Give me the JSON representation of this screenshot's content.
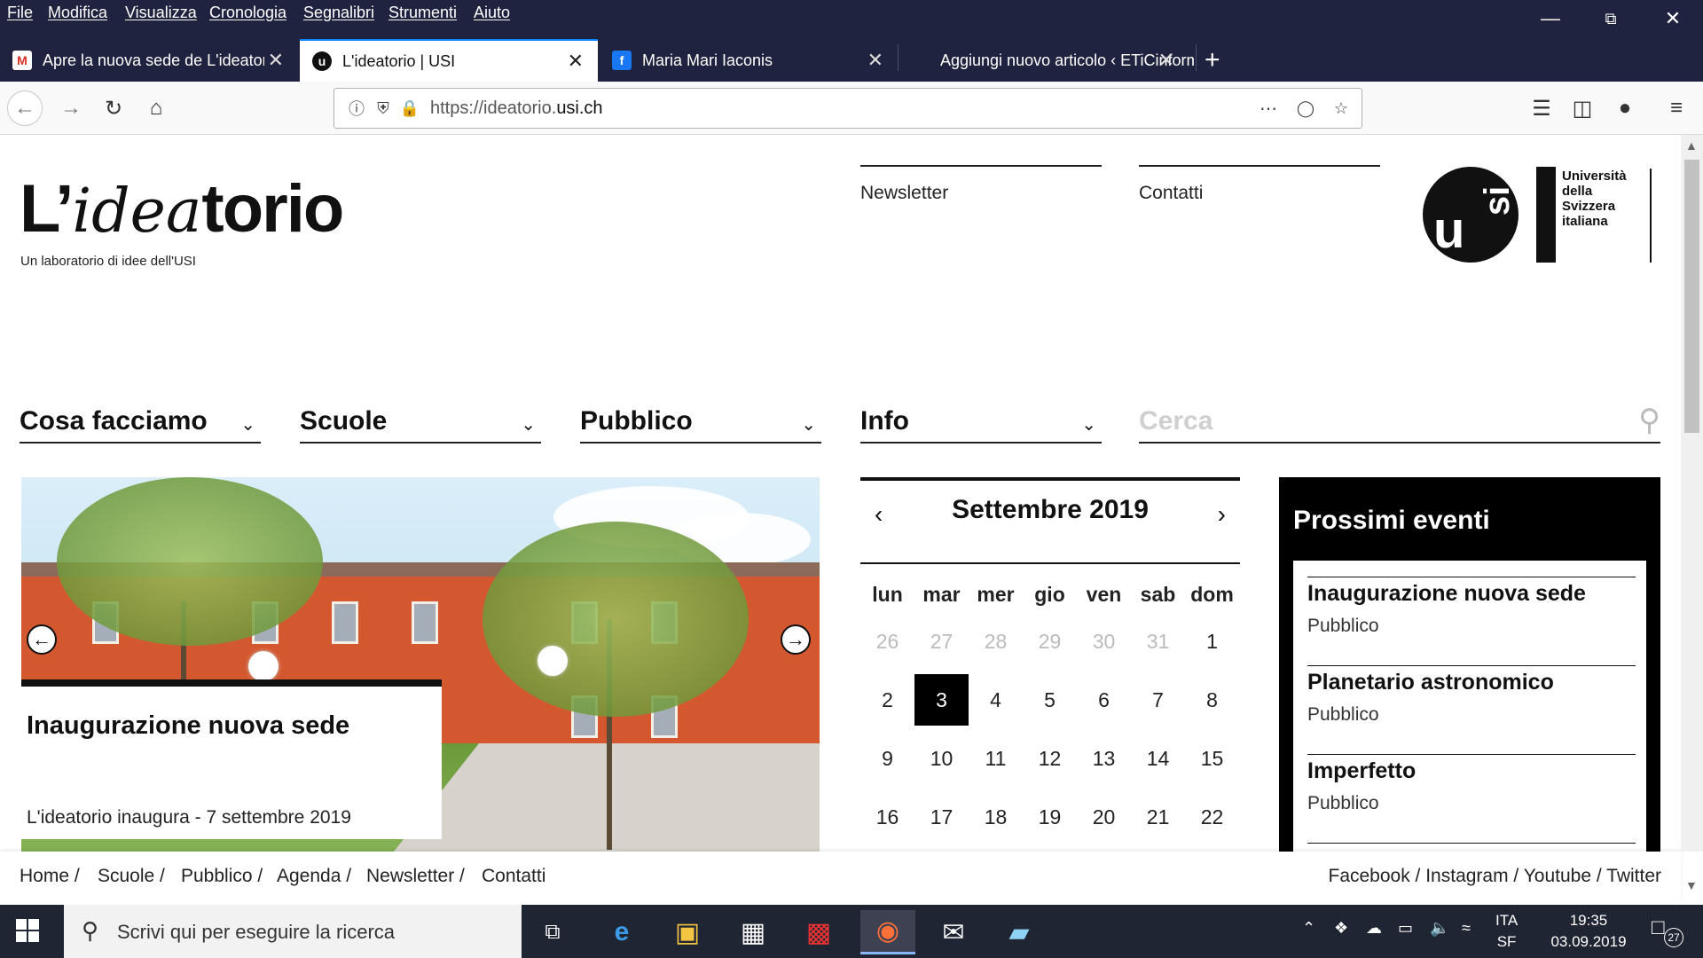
{
  "menubar": {
    "items": [
      "File",
      "Modifica",
      "Visualizza",
      "Cronologia",
      "Segnalibri",
      "Strumenti",
      "Aiuto"
    ]
  },
  "tabs": [
    {
      "title": "Apre la nuova sede de L'ideatorio",
      "favicon": "gmail-icon"
    },
    {
      "title": "L'ideatorio | USI",
      "favicon": "usi-icon",
      "active": true
    },
    {
      "title": "Maria Mari Iaconis",
      "favicon": "facebook-icon"
    },
    {
      "title": "Aggiungi nuovo articolo ‹ ETiCinforma",
      "favicon": "blank"
    }
  ],
  "urlbar": {
    "prefix": "https://ideatorio.",
    "domain": "usi.ch"
  },
  "site": {
    "logo_prefix": "L’",
    "logo_script": "idea",
    "logo_suffix": "torio",
    "tagline": "Un laboratorio di idee dell'USI",
    "top_links": [
      "Newsletter",
      "Contatti"
    ],
    "usi_lines": [
      "Università",
      "della",
      "Svizzera",
      "italiana"
    ],
    "usi_mark": {
      "u": "u",
      "si": "si"
    }
  },
  "mainnav": [
    "Cosa facciamo",
    "Scuole",
    "Pubblico",
    "Info"
  ],
  "search": {
    "placeholder": "Cerca"
  },
  "slider": {
    "title": "Inaugurazione nuova sede",
    "subtitle": "L'ideatorio inaugura - 7 settembre 2019"
  },
  "calendar": {
    "month": "Settembre 2019",
    "weekdays": [
      "lun",
      "mar",
      "mer",
      "gio",
      "ven",
      "sab",
      "dom"
    ],
    "rows": [
      [
        {
          "d": "26",
          "m": true
        },
        {
          "d": "27",
          "m": true
        },
        {
          "d": "28",
          "m": true
        },
        {
          "d": "29",
          "m": true
        },
        {
          "d": "30",
          "m": true
        },
        {
          "d": "31",
          "m": true
        },
        {
          "d": "1"
        }
      ],
      [
        {
          "d": "2"
        },
        {
          "d": "3",
          "today": true
        },
        {
          "d": "4"
        },
        {
          "d": "5"
        },
        {
          "d": "6"
        },
        {
          "d": "7"
        },
        {
          "d": "8"
        }
      ],
      [
        {
          "d": "9"
        },
        {
          "d": "10"
        },
        {
          "d": "11"
        },
        {
          "d": "12"
        },
        {
          "d": "13"
        },
        {
          "d": "14"
        },
        {
          "d": "15"
        }
      ],
      [
        {
          "d": "16"
        },
        {
          "d": "17"
        },
        {
          "d": "18"
        },
        {
          "d": "19"
        },
        {
          "d": "20"
        },
        {
          "d": "21"
        },
        {
          "d": "22"
        }
      ]
    ]
  },
  "events": {
    "heading": "Prossimi eventi",
    "items": [
      {
        "title": "Inaugurazione nuova sede",
        "category": "Pubblico"
      },
      {
        "title": "Planetario astronomico",
        "category": "Pubblico"
      },
      {
        "title": "Imperfetto",
        "category": "Pubblico"
      }
    ]
  },
  "footer": {
    "left": [
      "Home /",
      "Scuole /",
      "Pubblico /",
      "Agenda /",
      "Newsletter /",
      "Contatti"
    ],
    "right": "Facebook / Instagram / Youtube / Twitter"
  },
  "taskbar": {
    "search_placeholder": "Scrivi qui per eseguire la ricerca",
    "lang_top": "ITA",
    "lang_bottom": "SF",
    "time": "19:35",
    "date": "03.09.2019",
    "notifications": "27"
  },
  "colors": {
    "chrome_dark": "#202340",
    "accent_tab": "#0a84ff",
    "facebook": "#1877f2",
    "gmail": "#d93025"
  }
}
